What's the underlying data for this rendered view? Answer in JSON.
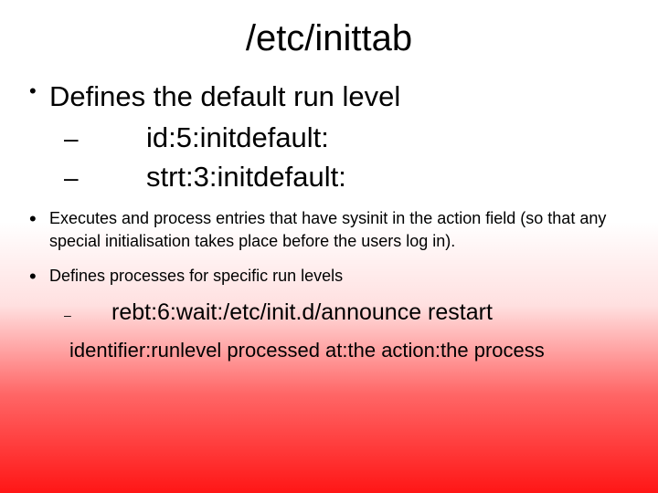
{
  "title": "/etc/inittab",
  "bullets": {
    "b1": {
      "text": "Defines the default run level",
      "sub1": "id:5:initdefault:",
      "sub2": "strt:3:initdefault:"
    },
    "b2": {
      "text": "Executes and process entries that have sysinit in the action field (so that any special initialisation takes place before the users log in)."
    },
    "b3": {
      "text": "Defines processes for specific run levels",
      "sub1": "rebt:6:wait:/etc/init.d/announce  restart"
    }
  },
  "footer": "identifier:runlevel processed at:the action:the process",
  "glyphs": {
    "bullet": "•",
    "dash": "–",
    "dash_sm": "–"
  }
}
